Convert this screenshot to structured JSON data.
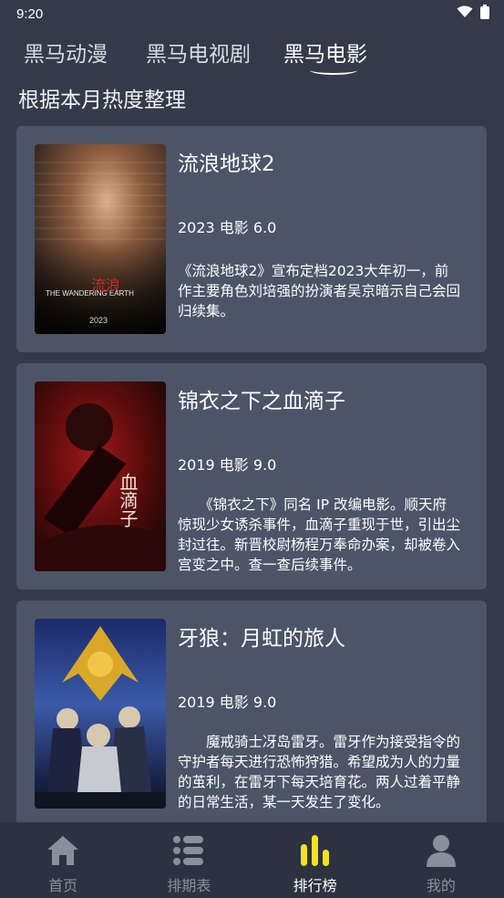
{
  "status_bar": {
    "time": "9:20"
  },
  "tabs": [
    {
      "label": "黑马动漫"
    },
    {
      "label": "黑马电视剧"
    },
    {
      "label": "黑马电影"
    }
  ],
  "section_title": "根据本月热度整理",
  "movies": [
    {
      "title": "流浪地球2",
      "meta": "2023 电影 6.0",
      "description": "《流浪地球2》宣布定档2023大年初一，前作主要角色刘培强的扮演者吴京暗示自己会回归续集。",
      "poster_text": "THE WANDERING EARTH",
      "poster_year": "2023"
    },
    {
      "title": "锦衣之下之血滴子",
      "meta": "2019 电影 9.0",
      "description": "　　《锦衣之下》同名 IP 改编电影。顺天府惊现少女诱杀事件，血滴子重现于世，引出尘封过往。新晋校尉杨程万奉命办案，却被卷入宫变之中。查一查后续事件。",
      "poster_text": "血滴子"
    },
    {
      "title": "牙狼：月虹的旅人",
      "meta": "2019 电影 9.0",
      "description": "　　魔戒骑士冴岛雷牙。雷牙作为接受指令的守护者每天进行恐怖狩猎。希望成为人的力量的茧利，在雷牙下每天培育花。两人过着平静的日常生活，某一天发生了变化。"
    }
  ],
  "bottom_nav": [
    {
      "label": "首页"
    },
    {
      "label": "排期表"
    },
    {
      "label": "排行榜"
    },
    {
      "label": "我的"
    }
  ],
  "colors": {
    "background": "#343a49",
    "card": "#4c5468",
    "nav_background": "#2d3240",
    "accent_yellow": "#f5e31a"
  }
}
